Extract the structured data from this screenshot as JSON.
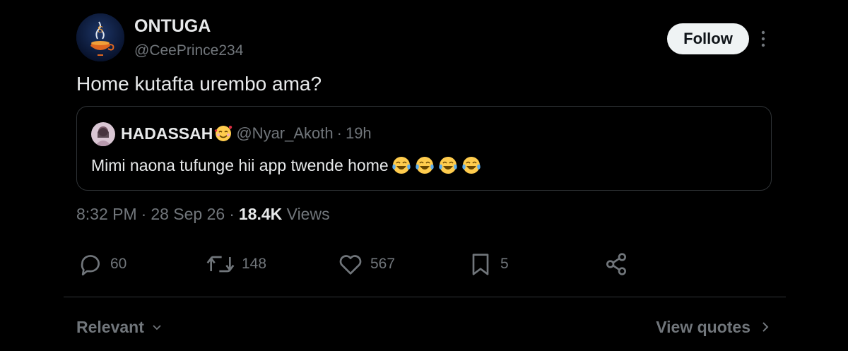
{
  "tweet": {
    "author": {
      "name": "ONTUGA",
      "handle": "@CeePrince234"
    },
    "follow_label": "Follow",
    "text": "Home kutafta urembo ama?",
    "quote": {
      "name": "HADASSAH",
      "handle": "@Nyar_Akoth",
      "separator": "·",
      "time": "19h",
      "text": "Mimi naona tufunge hii app twende home",
      "emoji_icon": "smiling-face-with-hearts-icon",
      "trailing_emoji": [
        "face-with-tears-of-joy-icon",
        "face-with-tears-of-joy-icon",
        "face-with-tears-of-joy-icon",
        "face-with-tears-of-joy-icon"
      ]
    },
    "meta": {
      "time": "8:32 PM",
      "sep1": "·",
      "date": "28 Sep 26",
      "sep2": "·",
      "views_count": "18.4K",
      "views_label": "Views"
    },
    "actions": {
      "replies": "60",
      "reposts": "148",
      "likes": "567",
      "bookmarks": "5"
    }
  },
  "footer": {
    "sort_label": "Relevant",
    "view_quotes_label": "View quotes"
  },
  "colors": {
    "background": "#000000",
    "text_primary": "#e7e9ea",
    "text_secondary": "#71767b",
    "border": "#2f3336",
    "follow_bg": "#eff3f4"
  }
}
